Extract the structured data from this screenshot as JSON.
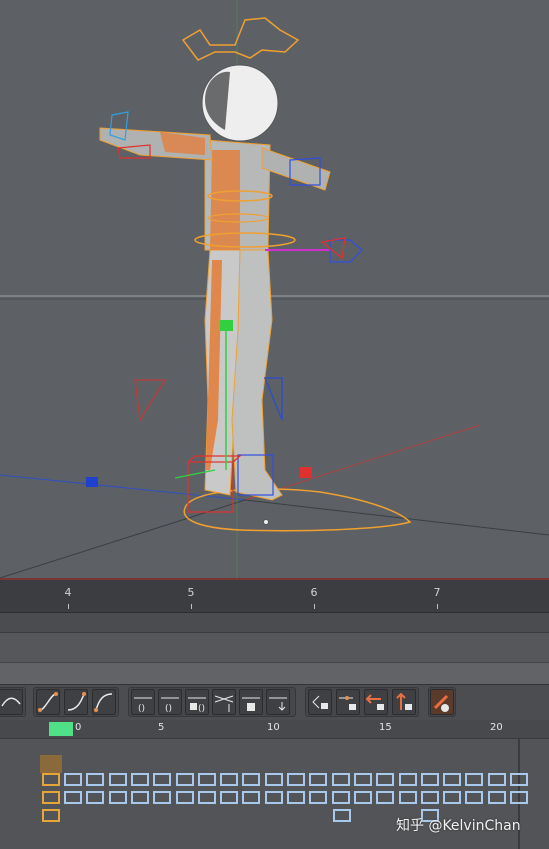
{
  "viewport": {
    "label": "3D viewport",
    "colors": {
      "background": "#5d6166",
      "rig_orange": "#f0a030",
      "handle_red": "#e03030",
      "handle_blue": "#3050e0",
      "handle_green": "#30d040",
      "handle_magenta": "#d030d0"
    }
  },
  "ruler": {
    "labels": [
      "4",
      "5",
      "6",
      "7"
    ]
  },
  "timeline": {
    "frame_labels": [
      "0",
      "5",
      "10",
      "15",
      "20"
    ],
    "playhead_color": "#4fe088"
  },
  "toolbar": {
    "groups": [
      {
        "name": "curve-tools",
        "icons": [
          "curve-ease-icon"
        ]
      },
      {
        "name": "tangent-tools",
        "icons": [
          "tangent-spline-icon",
          "tangent-ease-in-icon",
          "tangent-ease-out-icon"
        ]
      },
      {
        "name": "key-tools",
        "icons": [
          "key-break-icon",
          "key-unify-icon",
          "key-weight-icon",
          "key-lock-icon",
          "key-weight-lock-icon",
          "key-flatten-icon"
        ]
      },
      {
        "name": "lock-tools",
        "icons": [
          "lock-tangent-icon",
          "lock-key-icon",
          "lock-time-icon",
          "lock-value-icon"
        ]
      },
      {
        "name": "extra-tools",
        "icons": [
          "auto-tangent-icon"
        ]
      }
    ]
  },
  "watermark": "知乎 @KelvinChan"
}
